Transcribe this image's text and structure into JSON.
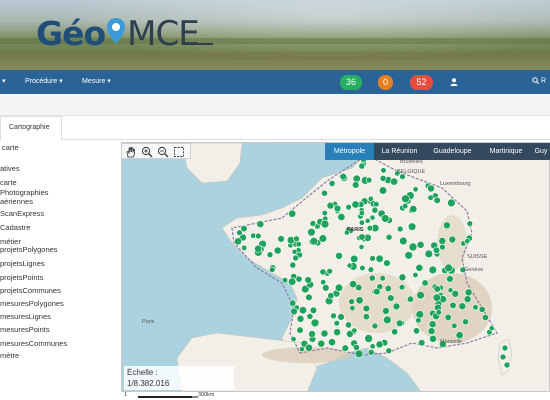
{
  "app": {
    "logo_geo": "Géo",
    "logo_mce": "MCE"
  },
  "nav": {
    "items": [
      {
        "label": "▾"
      },
      {
        "label": "Procédure ▾"
      },
      {
        "label": "Mesure ▾"
      }
    ],
    "badges": {
      "green": "36",
      "orange": "0",
      "red": "52"
    },
    "search_label": "R"
  },
  "tabs": {
    "cartographie": "Cartographie"
  },
  "layers": [
    "carte",
    "atives",
    "carte",
    "Photographies",
    "aériennes",
    "ScanExpress",
    "Cadastre",
    "métier",
    "projetsPolygones",
    "projetsLignes",
    "projetsPoints",
    "projetsCommunes",
    "mesuresPolygones",
    "mesuresLignes",
    "mesuresPoints",
    "mesuresCommunes",
    "mètre"
  ],
  "map": {
    "region_tabs": [
      "Métropole",
      "La Réunion",
      "Guadeloupe",
      "Martinique",
      "Guy"
    ],
    "active_region": "Métropole",
    "scale_label": "Échelle :",
    "scale_value": "1/8.382.016",
    "scale_bar_left": "1",
    "scale_bar_right": "300km",
    "place_labels": [
      "Bruxelles",
      "BELGIQUE",
      "Luxembourg",
      "PARIS",
      "Genève",
      "SUISSE",
      "Marseille",
      "Paris"
    ],
    "marker_color": "#1fa35c",
    "land_color": "#f2efe9",
    "sea_color": "#aad3df"
  }
}
